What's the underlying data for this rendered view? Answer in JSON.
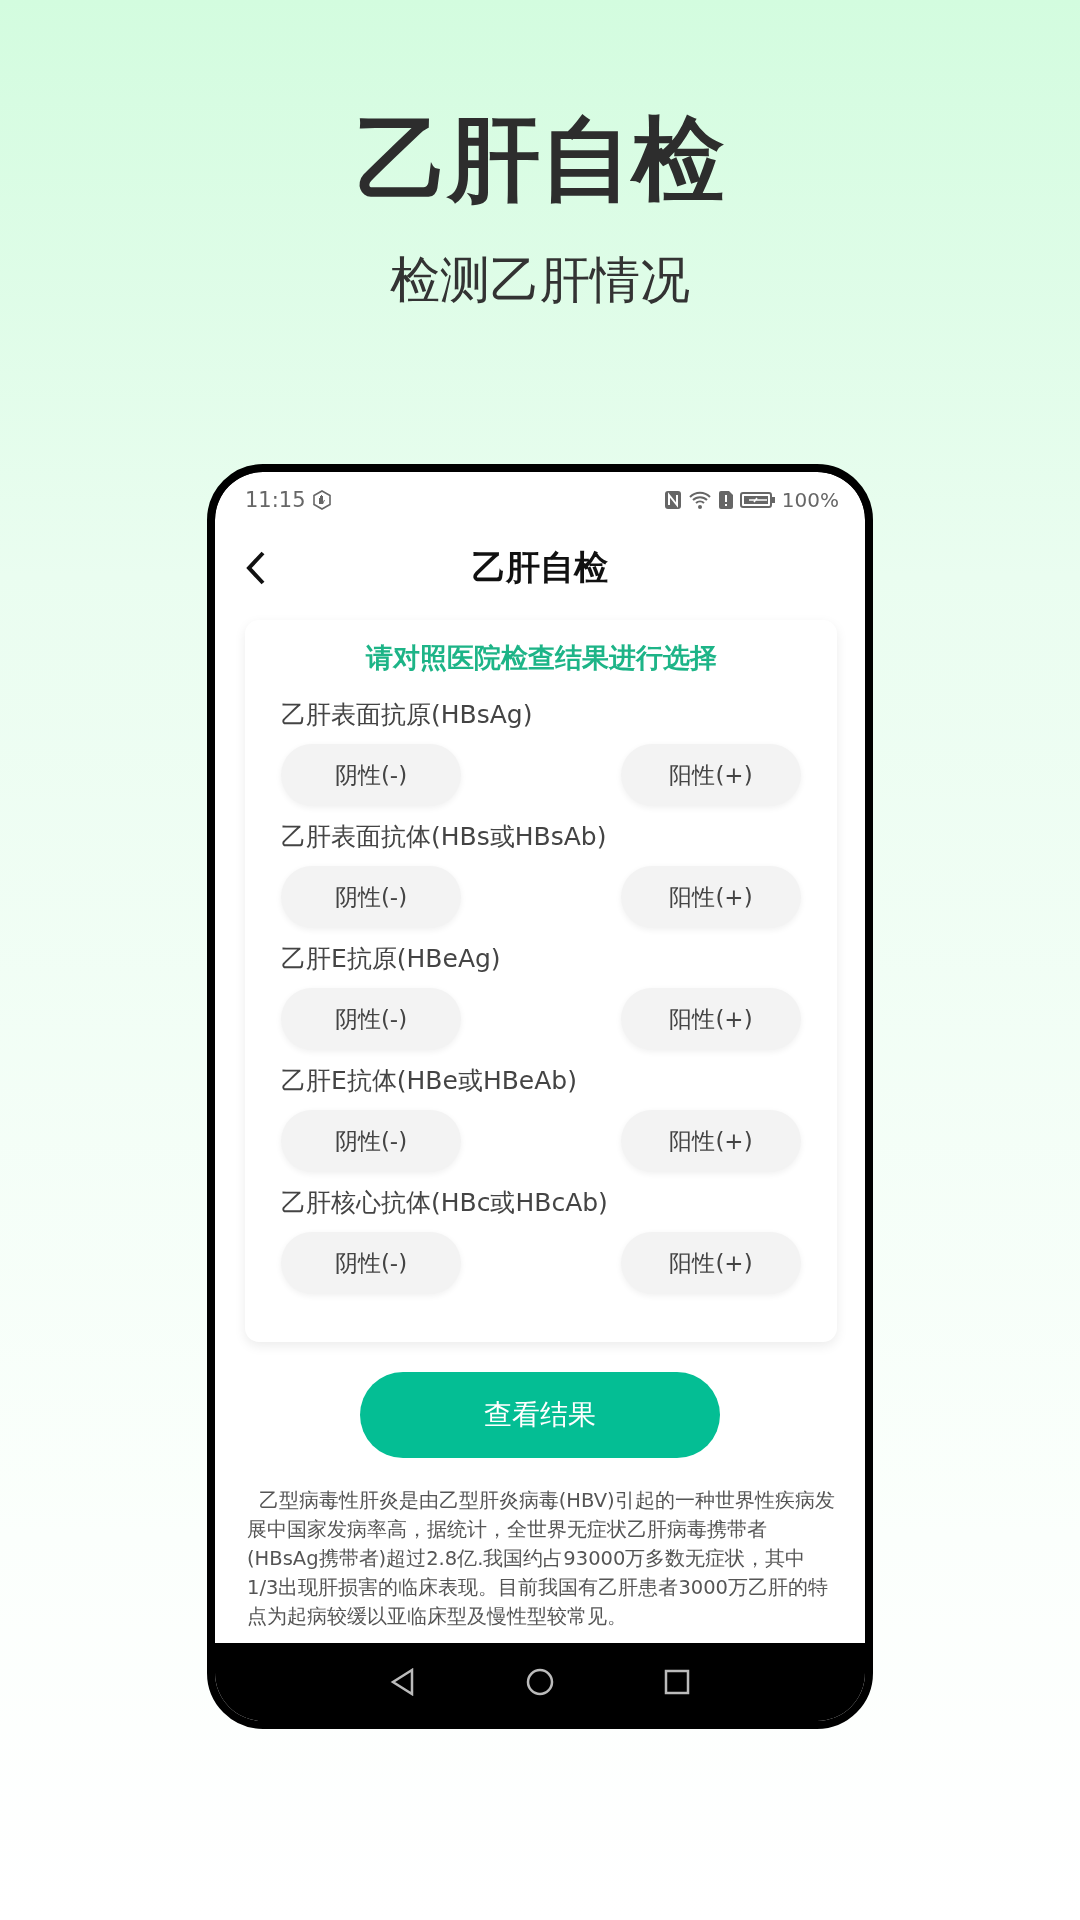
{
  "headline": "乙肝自检",
  "subheadline": "检测乙肝情况",
  "status_bar": {
    "time": "11:15",
    "battery": "100%"
  },
  "app_bar": {
    "title": "乙肝自检"
  },
  "card": {
    "instruction": "请对照医院检查结果进行选择",
    "questions": [
      {
        "label": "乙肝表面抗原(HBsAg)",
        "options": [
          {
            "label": "阴性(-)",
            "selected": false
          },
          {
            "label": "阳性(+)",
            "selected": false
          }
        ]
      },
      {
        "label": "乙肝表面抗体(HBs或HBsAb)",
        "options": [
          {
            "label": "阴性(-)",
            "selected": false
          },
          {
            "label": "阳性(+)",
            "selected": false
          }
        ]
      },
      {
        "label": "乙肝E抗原(HBeAg)",
        "options": [
          {
            "label": "阴性(-)",
            "selected": false
          },
          {
            "label": "阳性(+)",
            "selected": false
          }
        ]
      },
      {
        "label": "乙肝E抗体(HBe或HBeAb)",
        "options": [
          {
            "label": "阴性(-)",
            "selected": false
          },
          {
            "label": "阳性(+)",
            "selected": false
          }
        ]
      },
      {
        "label": "乙肝核心抗体(HBc或HBcAb)",
        "options": [
          {
            "label": "阴性(-)",
            "selected": false
          },
          {
            "label": "阳性(+)",
            "selected": false
          }
        ]
      }
    ]
  },
  "submit_button": "查看结果",
  "description": "乙型病毒性肝炎是由乙型肝炎病毒(HBV)引起的一种世界性疾病发展中国家发病率高，据统计，全世界无症状乙肝病毒携带者(HBsAg携带者)超过2.8亿.我国约占93000万多数无症状，其中1/3出现肝损害的临床表现。目前我国有乙肝患者3000万乙肝的特点为起病较缓以亚临床型及慢性型较常见。"
}
